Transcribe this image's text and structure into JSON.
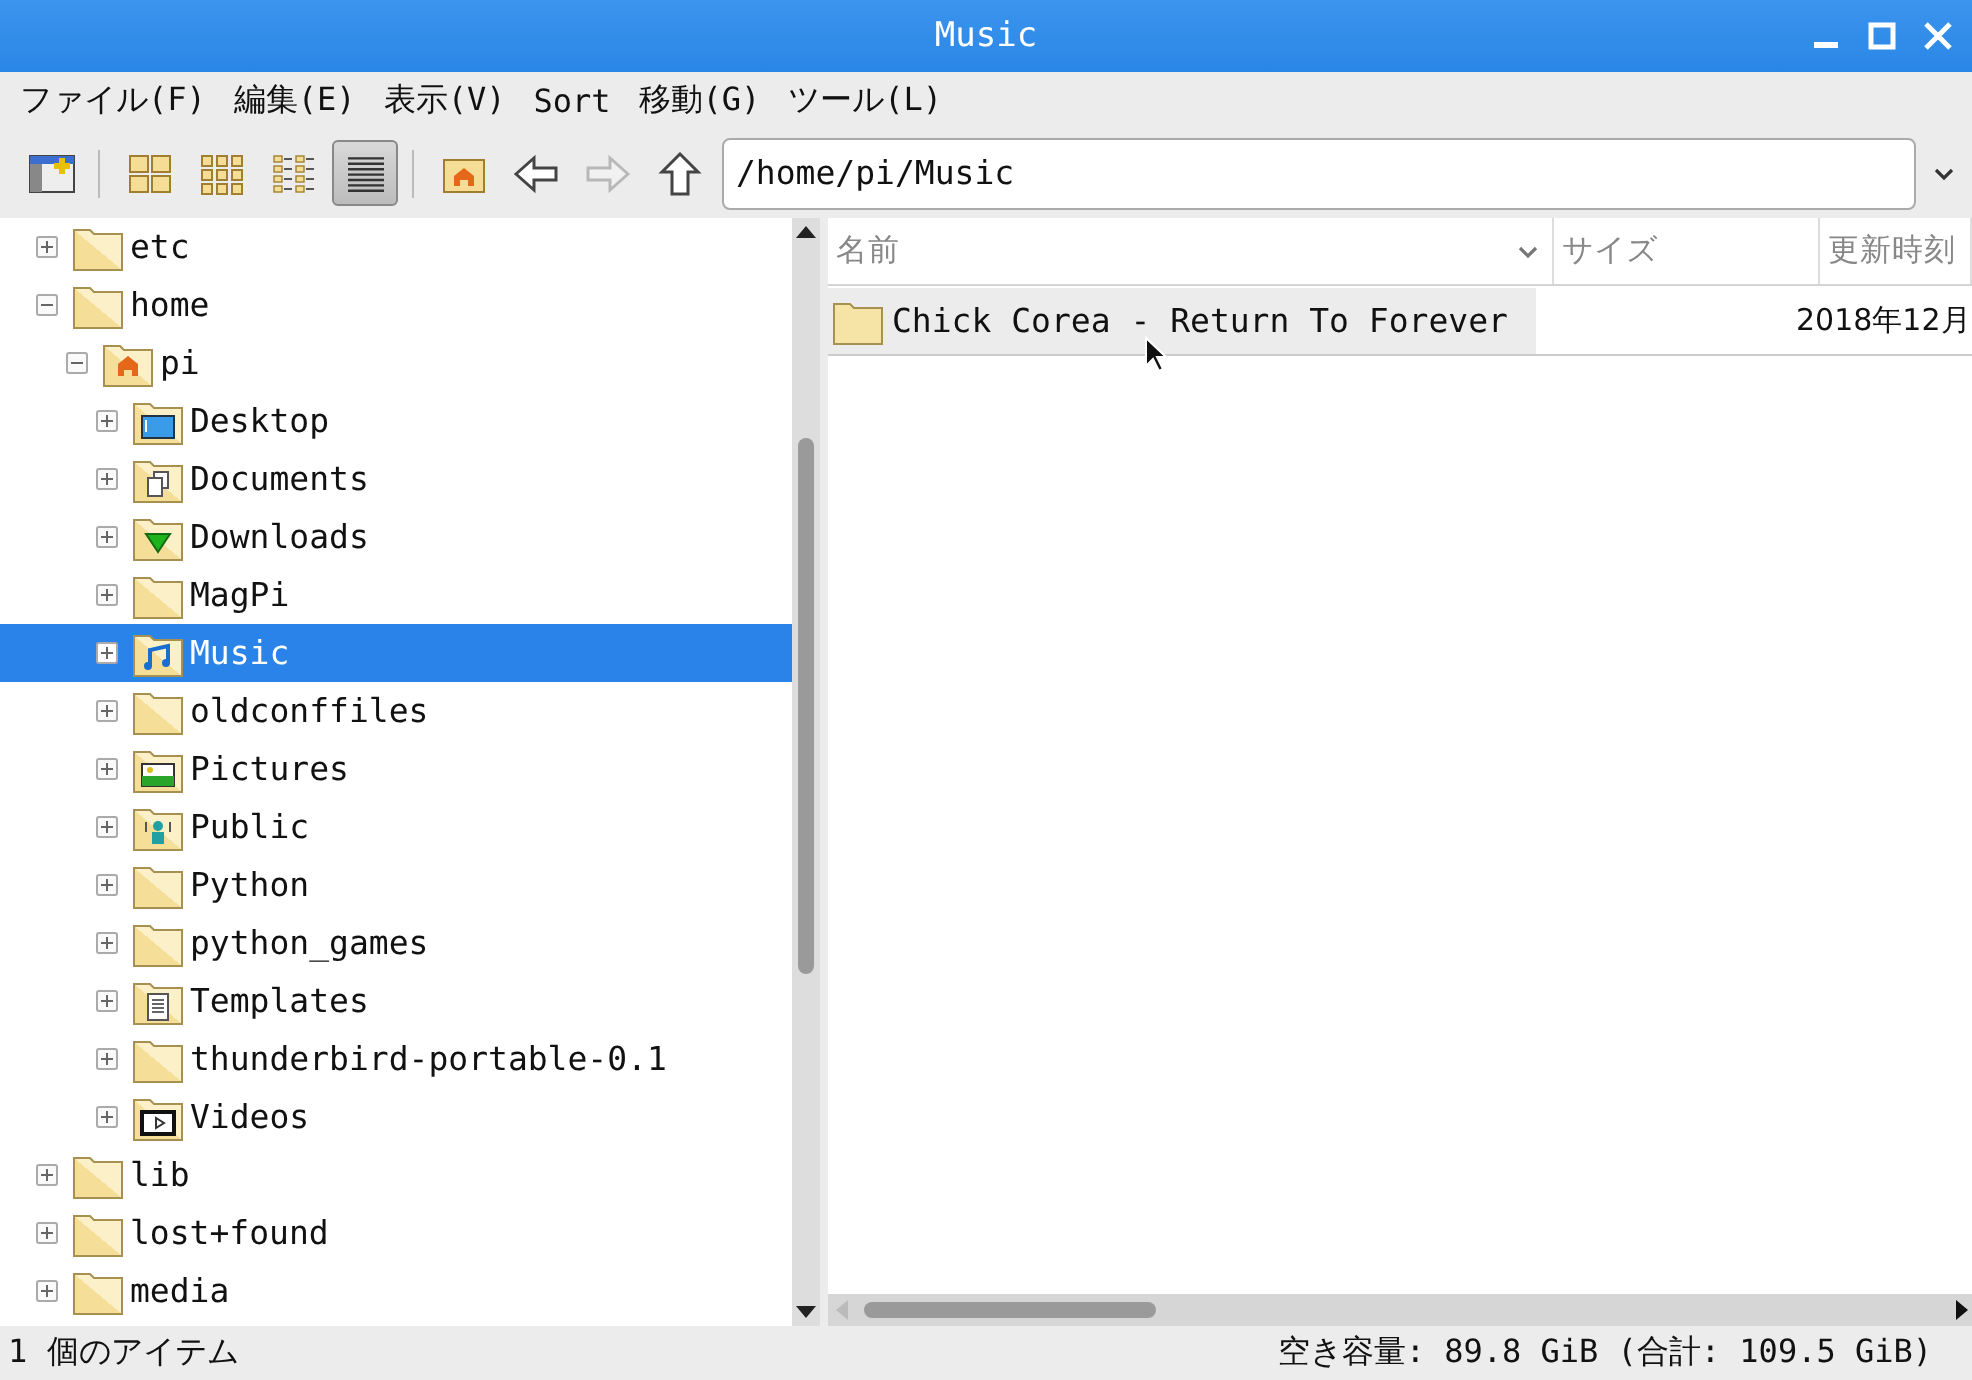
{
  "window": {
    "title": "Music"
  },
  "menu": [
    "ファイル(F)",
    "編集(E)",
    "表示(V)",
    "Sort",
    "移動(G)",
    "ツール(L)"
  ],
  "toolbar": {
    "view_modes": [
      {
        "kind": "view-icons",
        "selected": false
      },
      {
        "kind": "view-thumbnails",
        "selected": false
      },
      {
        "kind": "view-compact",
        "selected": false
      },
      {
        "kind": "view-list",
        "selected": true
      }
    ],
    "nav": [
      {
        "kind": "home",
        "disabled": false
      },
      {
        "kind": "back",
        "disabled": false
      },
      {
        "kind": "forward",
        "disabled": true
      },
      {
        "kind": "up",
        "disabled": false
      }
    ],
    "path": "/home/pi/Music"
  },
  "tree": [
    {
      "label": "etc",
      "kind": "folder",
      "expanded": false,
      "selected": false
    },
    {
      "label": "home",
      "kind": "folder",
      "expanded": true,
      "selected": false,
      "children": [
        {
          "label": "pi",
          "kind": "home",
          "expanded": true,
          "selected": false,
          "children": [
            {
              "label": "Desktop",
              "kind": "desktop",
              "expanded": false,
              "selected": false
            },
            {
              "label": "Documents",
              "kind": "documents",
              "expanded": false,
              "selected": false
            },
            {
              "label": "Downloads",
              "kind": "downloads",
              "expanded": false,
              "selected": false
            },
            {
              "label": "MagPi",
              "kind": "folder",
              "expanded": false,
              "selected": false
            },
            {
              "label": "Music",
              "kind": "music",
              "expanded": false,
              "selected": true
            },
            {
              "label": "oldconffiles",
              "kind": "folder",
              "expanded": false,
              "selected": false
            },
            {
              "label": "Pictures",
              "kind": "pictures",
              "expanded": false,
              "selected": false
            },
            {
              "label": "Public",
              "kind": "public",
              "expanded": false,
              "selected": false
            },
            {
              "label": "Python",
              "kind": "folder",
              "expanded": false,
              "selected": false
            },
            {
              "label": "python_games",
              "kind": "folder",
              "expanded": false,
              "selected": false
            },
            {
              "label": "Templates",
              "kind": "templates",
              "expanded": false,
              "selected": false
            },
            {
              "label": "thunderbird-portable-0.1",
              "kind": "folder",
              "expanded": false,
              "selected": false
            },
            {
              "label": "Videos",
              "kind": "videos",
              "expanded": false,
              "selected": false
            }
          ]
        }
      ]
    },
    {
      "label": "lib",
      "kind": "folder",
      "expanded": false,
      "selected": false
    },
    {
      "label": "lost+found",
      "kind": "folder",
      "expanded": false,
      "selected": false
    },
    {
      "label": "media",
      "kind": "folder",
      "expanded": false,
      "selected": false
    }
  ],
  "files": {
    "columns": [
      {
        "label": "名前",
        "sorted": true
      },
      {
        "label": "サイズ",
        "sorted": false
      },
      {
        "label": "更新時刻",
        "sorted": false
      }
    ],
    "rows": [
      {
        "name": "Chick Corea - Return To Forever",
        "modified": "2018年12月",
        "hovered": true
      }
    ]
  },
  "status_bar": {
    "items": "1 個のアイテム",
    "free_space": "空き容量: 89.8 GiB (合計: 109.5 GiB)"
  }
}
